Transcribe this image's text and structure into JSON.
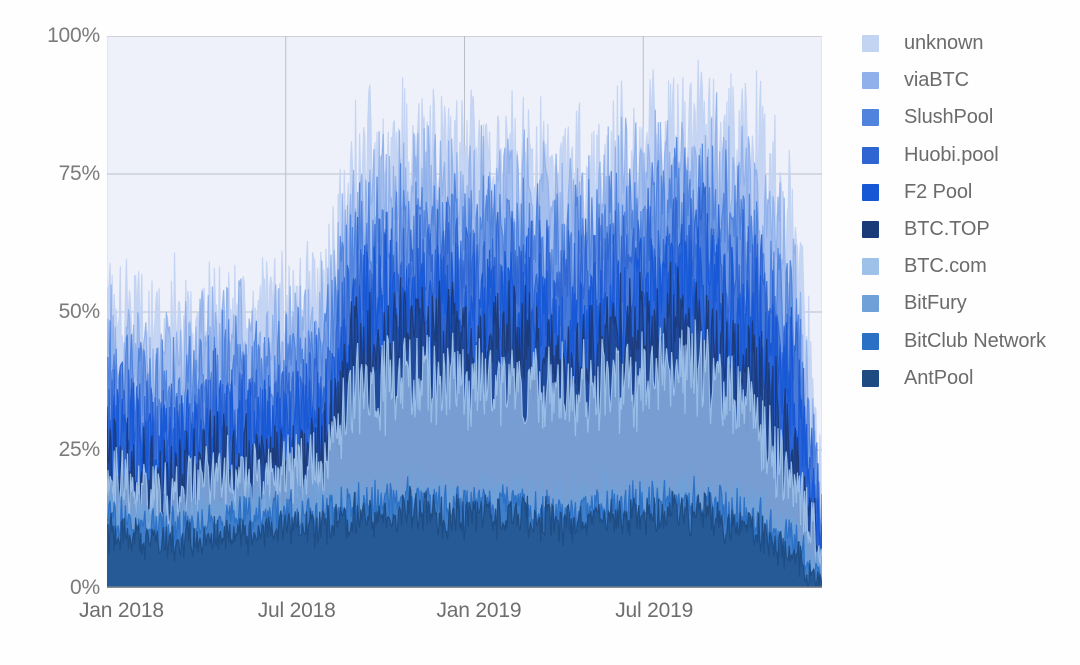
{
  "chart_data": {
    "type": "area",
    "title": "",
    "subtitle": "",
    "xlabel": "",
    "ylabel": "",
    "ylim": [
      0,
      100
    ],
    "yticks": [
      "0%",
      "25%",
      "50%",
      "75%",
      "100%"
    ],
    "ytick_values": [
      0,
      25,
      50,
      75,
      100
    ],
    "xticks": [
      "Jan 2018",
      "Jul 2018",
      "Jan 2019",
      "Jul 2019"
    ],
    "xtick_values": [
      "2018-01",
      "2018-07",
      "2019-01",
      "2019-07"
    ],
    "x_range": [
      "Jan 2018",
      "Dec 2019"
    ],
    "grid": true,
    "legend_position": "right",
    "stacked": true,
    "plot_background": "#eef1fa",
    "axis_color": "#9aa0a6",
    "series": [
      {
        "name": "unknown",
        "color": "#c3d3f2",
        "baseline": 18,
        "values_description": "cumulative top band; ~50-55% early 2018 rising to ~75-84% after Aug 2018, falling to ~55% late 2019",
        "values": [
          52,
          50,
          48,
          47,
          49,
          51,
          50,
          53,
          76,
          78,
          80,
          79,
          77,
          78,
          76,
          75,
          77,
          79,
          81,
          84,
          82,
          78,
          70,
          56
        ]
      },
      {
        "name": "viaBTC",
        "color": "#8fb0ea",
        "values_description": "mid-upper band, noisy 40-75%",
        "values": [
          44,
          42,
          41,
          43,
          45,
          44,
          46,
          48,
          68,
          70,
          72,
          71,
          69,
          70,
          68,
          67,
          70,
          72,
          74,
          76,
          73,
          68,
          58,
          48
        ]
      },
      {
        "name": "SlushPool",
        "color": "#4f83dd",
        "values_description": "upper-mid band 35-70%",
        "values": [
          38,
          36,
          35,
          37,
          39,
          38,
          40,
          42,
          62,
          64,
          66,
          65,
          63,
          64,
          62,
          61,
          64,
          66,
          68,
          70,
          66,
          60,
          50,
          42
        ]
      },
      {
        "name": "Huobi.pool",
        "color": "#2f65d2",
        "values_description": "mid band 30-62%",
        "values": [
          32,
          30,
          29,
          31,
          33,
          32,
          34,
          36,
          55,
          57,
          59,
          58,
          56,
          57,
          55,
          54,
          57,
          59,
          61,
          62,
          58,
          52,
          43,
          36
        ]
      },
      {
        "name": "F2 Pool",
        "color": "#1657d6",
        "values_description": "mid band 26-56%",
        "values": [
          28,
          26,
          25,
          27,
          29,
          28,
          30,
          32,
          49,
          51,
          53,
          52,
          50,
          51,
          49,
          48,
          51,
          53,
          55,
          56,
          52,
          46,
          38,
          31
        ]
      },
      {
        "name": "BTC.TOP",
        "color": "#1b3a78",
        "values_description": "dark navy line ~20-47%, drops sharply to ~20% at end of 2019",
        "values": [
          23,
          21,
          20,
          22,
          24,
          23,
          25,
          26,
          45,
          46,
          47,
          46,
          44,
          45,
          43,
          42,
          45,
          46,
          47,
          47,
          43,
          36,
          24,
          20
        ]
      },
      {
        "name": "BTC.com",
        "color": "#9dc1e9",
        "values_description": "light blue band ~17-40%",
        "values": [
          19,
          17,
          16,
          18,
          20,
          19,
          21,
          22,
          36,
          37,
          38,
          38,
          36,
          37,
          35,
          35,
          37,
          38,
          39,
          40,
          36,
          30,
          20,
          16
        ]
      },
      {
        "name": "BitFury",
        "color": "#6fa0d8",
        "values_description": "lower band ~13-18%",
        "values": [
          15,
          14,
          13,
          14,
          15,
          15,
          16,
          16,
          17,
          17,
          18,
          17,
          17,
          17,
          16,
          16,
          17,
          17,
          18,
          18,
          16,
          14,
          11,
          8
        ]
      },
      {
        "name": "BitClub Network",
        "color": "#2a70c5",
        "values_description": "low band ~11-16%",
        "values": [
          13,
          12,
          11,
          12,
          13,
          13,
          14,
          14,
          15,
          15,
          16,
          15,
          15,
          15,
          14,
          14,
          15,
          15,
          16,
          16,
          14,
          12,
          9,
          5
        ]
      },
      {
        "name": "AntPool",
        "color": "#1d4b82",
        "values_description": "lowest dark band ~8-14%",
        "values": [
          10,
          9,
          8,
          9,
          10,
          10,
          11,
          11,
          13,
          13,
          14,
          13,
          13,
          13,
          12,
          12,
          13,
          13,
          14,
          14,
          12,
          10,
          6,
          3
        ]
      }
    ],
    "annotations": [
      "Step increase in aggregate share around Aug/Sep 2018",
      "Sharp decline in all series at the far right (late 2019)"
    ]
  },
  "legend": {
    "items": [
      {
        "label": "unknown",
        "color": "#c3d3f2"
      },
      {
        "label": "viaBTC",
        "color": "#8fb0ea"
      },
      {
        "label": "SlushPool",
        "color": "#4f83dd"
      },
      {
        "label": "Huobi.pool",
        "color": "#2f65d2"
      },
      {
        "label": "F2 Pool",
        "color": "#1657d6"
      },
      {
        "label": "BTC.TOP",
        "color": "#1b3a78"
      },
      {
        "label": "BTC.com",
        "color": "#9dc1e9"
      },
      {
        "label": "BitFury",
        "color": "#6fa0d8"
      },
      {
        "label": "BitClub Network",
        "color": "#2a70c5"
      },
      {
        "label": "AntPool",
        "color": "#1d4b82"
      }
    ]
  }
}
